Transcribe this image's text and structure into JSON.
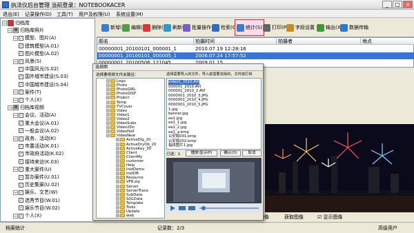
{
  "title": "执法仪后台管理    当前登录：NOTEBOOKACER",
  "menu": [
    "退出(E)",
    "记录操作(D)",
    "工具(T)",
    "用户及权限(U)",
    "系统设置(M)"
  ],
  "tree": [
    {
      "label": "归档库",
      "d": 0,
      "type": "root"
    },
    {
      "label": "归档库照片",
      "d": 1,
      "type": "folder"
    },
    {
      "label": "模型、图片(A)",
      "d": 2,
      "type": "check"
    },
    {
      "label": "建筑模型(A.01)",
      "d": 3,
      "type": "check"
    },
    {
      "label": "图片模型(A.02)",
      "d": 3,
      "type": "check"
    },
    {
      "label": "风景(S)",
      "d": 2,
      "type": "check"
    },
    {
      "label": "中国风光(S.02)",
      "d": 3,
      "type": "check"
    },
    {
      "label": "国外城市建设(S.03)",
      "d": 3,
      "type": "check"
    },
    {
      "label": "中国城市建设(S.04)",
      "d": 3,
      "type": "check"
    },
    {
      "label": "案件(T)",
      "d": 2,
      "type": "check"
    },
    {
      "label": "个人(X)",
      "d": 2,
      "type": "check"
    },
    {
      "label": "归档库视频",
      "d": 1,
      "type": "folder"
    },
    {
      "label": "会议、活动(A)",
      "d": 2,
      "type": "check"
    },
    {
      "label": "重大会议(A.01)",
      "d": 3,
      "type": "check"
    },
    {
      "label": "一般会议(A.02)",
      "d": 3,
      "type": "check"
    },
    {
      "label": "政务、活动(K)",
      "d": 2,
      "type": "check"
    },
    {
      "label": "市委活动(K.01)",
      "d": 3,
      "type": "check"
    },
    {
      "label": "市政府活动(K.02)",
      "d": 3,
      "type": "check"
    },
    {
      "label": "接待来访(K.03)",
      "d": 3,
      "type": "check"
    },
    {
      "label": "重大案件(U)",
      "d": 2,
      "type": "check"
    },
    {
      "label": "暂办案件(U.01)",
      "d": 3,
      "type": "check"
    },
    {
      "label": "历史集案(U.02)",
      "d": 3,
      "type": "check"
    },
    {
      "label": "娱乐、文艺(W)",
      "d": 2,
      "type": "check"
    },
    {
      "label": "选秀节目(W.01)",
      "d": 3,
      "type": "check"
    },
    {
      "label": "娱乐节目(W.02)",
      "d": 3,
      "type": "check"
    },
    {
      "label": "个人(X)",
      "d": 2,
      "type": "check"
    }
  ],
  "toolbar": [
    {
      "label": "新增(N)",
      "color": "#3a7bd5"
    },
    {
      "label": "编辑(E)",
      "color": "#4aa04a"
    },
    {
      "label": "删除(D)",
      "color": "#d33"
    },
    {
      "label": "刷新(R)",
      "color": "#2a9ad0"
    },
    {
      "label": "批量操作",
      "color": "#7a5acb"
    },
    {
      "label": "检索(Q)",
      "color": "#2b6cc4"
    },
    {
      "label": "统计(S)",
      "color": "#3a7bd5"
    },
    {
      "label": "打印(P)",
      "color": "#666"
    },
    {
      "label": "字段设置",
      "color": "#c98a20"
    },
    {
      "label": "输出(X)",
      "color": "#3a9a3a"
    },
    {
      "label": "数据传输",
      "color": "#2a7ad5"
    }
  ],
  "columns": [
    "题名",
    "拍摄时间",
    "拍摄者",
    "地点"
  ],
  "rows": [
    [
      "00000001_20100101_000001_1",
      "2010.07.19 12:28:16",
      "",
      ""
    ],
    [
      "00000001_20100101_000005_1",
      "2006.07.24 17:57:52",
      "",
      ""
    ],
    [
      "00000001_20100506_121045",
      "2009.01.15",
      "",
      ""
    ]
  ],
  "dialog": {
    "title": "选择图",
    "left_hint": "选择要视频文件夹路径：",
    "right_hint": "选择需要导入的文件，导入前需要去除的，文件前打钩",
    "folders": [
      "Logo",
      "Photo",
      "PhotoGIRL",
      "PhotoGISP",
      "Project",
      "Temp",
      "TVCover",
      "Video",
      "Video1",
      "Video2",
      "VideoSubs",
      "Video2Dn",
      "VideoHall",
      "VideoNew",
      "ActiveDlg_20",
      "ActiveDryOb_20",
      "ActiveKey_30",
      "Client",
      "ClientMy",
      "customer",
      "Help",
      "InstDemo",
      "InstDB",
      "Resource",
      "VFR.zip",
      "Server",
      "ServerTrans",
      "SubData",
      "SQLData",
      "Template",
      "Tools",
      "Update",
      "web"
    ],
    "files": [
      "video1_2010.AVI",
      "000001_2010.AVI",
      "000001_2010_2.AVI",
      "0000001_2010_3.JPG",
      "0000001_2010_4.JPG",
      "0000001_2010_5.JPG",
      "1.jpg",
      "banner.jpg",
      "ee1.jpg",
      "ee1_1.jpg",
      "ee1_2.jpg",
      "ee1_a.bmp",
      "公安局001.bmp",
      "公安局002.bmp",
      "指纹图片1.jpg"
    ],
    "selected_count": "已选：1",
    "preview_btn": "播放/显示(P)",
    "ok_btn": "确认(O)",
    "cancel_btn": "取消"
  },
  "bottom": {
    "contrast": "调节图像",
    "import": "获取图像",
    "show": "显示图像"
  },
  "status": {
    "left": "档案统计",
    "count": "记录数：2/3",
    "user": "高级用户"
  }
}
